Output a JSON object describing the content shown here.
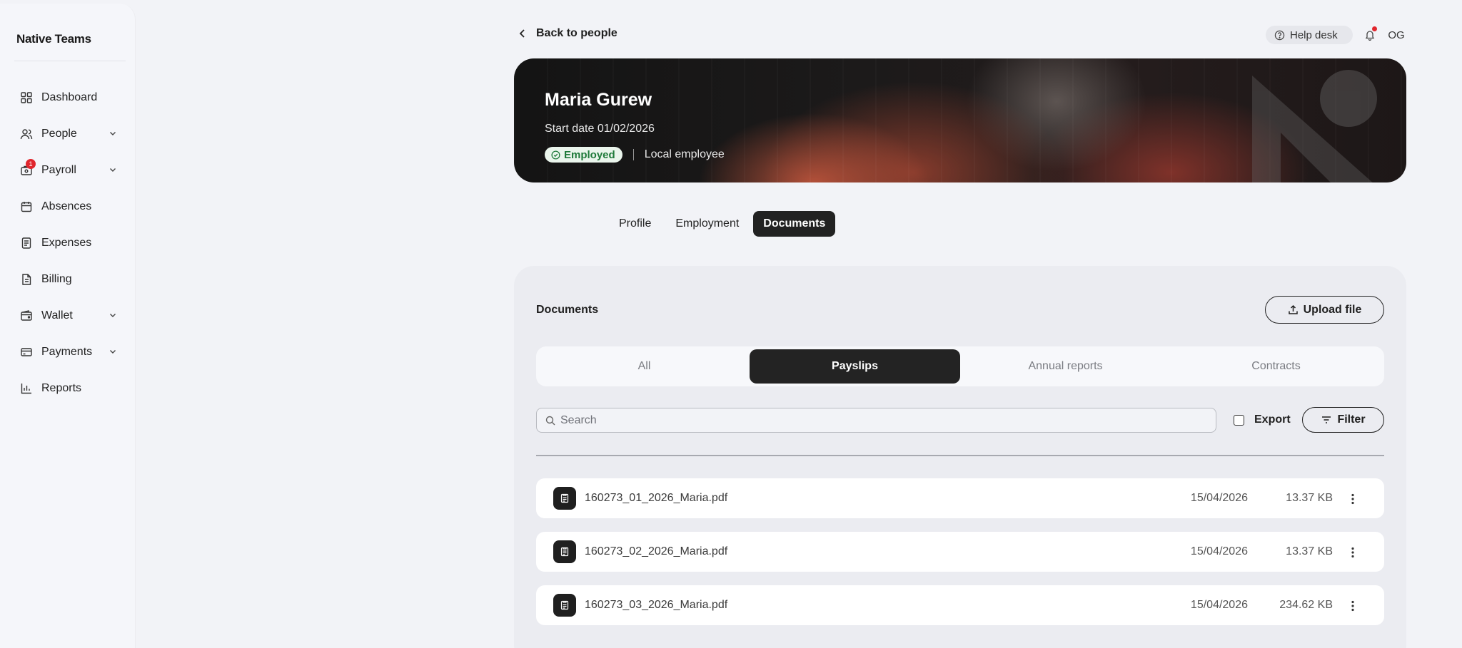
{
  "brand": {
    "logo_text": "Native Teams"
  },
  "sidebar": {
    "items": [
      {
        "label": "Dashboard",
        "icon": "grid-icon",
        "has_chevron": false
      },
      {
        "label": "People",
        "icon": "people-icon",
        "has_chevron": true
      },
      {
        "label": "Payroll",
        "icon": "payroll-icon",
        "has_chevron": true,
        "badge": "1"
      },
      {
        "label": "Absences",
        "icon": "calendar-icon",
        "has_chevron": false
      },
      {
        "label": "Expenses",
        "icon": "receipt-icon",
        "has_chevron": false
      },
      {
        "label": "Billing",
        "icon": "invoice-icon",
        "has_chevron": false
      },
      {
        "label": "Wallet",
        "icon": "wallet-icon",
        "has_chevron": true
      },
      {
        "label": "Payments",
        "icon": "card-icon",
        "has_chevron": true
      },
      {
        "label": "Reports",
        "icon": "bar-chart-icon",
        "has_chevron": false
      }
    ]
  },
  "topbar": {
    "back_label": "Back to people",
    "helpdesk_label": "Help desk",
    "avatar_initials": "OG",
    "notification_dot_color": "#e0262d"
  },
  "employee": {
    "name": "Maria Gurew",
    "start_date": "Start date 01/02/2026",
    "status": "Employed",
    "employment_type": "Local employee",
    "status_color": "#1f7a3a"
  },
  "profile_tabs": [
    {
      "label": "Profile",
      "active": false
    },
    {
      "label": "Employment",
      "active": false
    },
    {
      "label": "Documents",
      "active": true
    }
  ],
  "documents": {
    "title": "Documents",
    "upload_label": "Upload file",
    "categories": [
      {
        "label": "All",
        "active": false
      },
      {
        "label": "Payslips",
        "active": true
      },
      {
        "label": "Annual reports",
        "active": false
      },
      {
        "label": "Contracts",
        "active": false
      }
    ],
    "search_placeholder": "Search",
    "export_label": "Export",
    "filter_label": "Filter",
    "files": [
      {
        "name": "160273_01_2026_Maria.pdf",
        "date": "15/04/2026",
        "size": "13.37 KB"
      },
      {
        "name": "160273_02_2026_Maria.pdf",
        "date": "15/04/2026",
        "size": "13.37 KB"
      },
      {
        "name": "160273_03_2026_Maria.pdf",
        "date": "15/04/2026",
        "size": "234.62 KB"
      }
    ]
  }
}
